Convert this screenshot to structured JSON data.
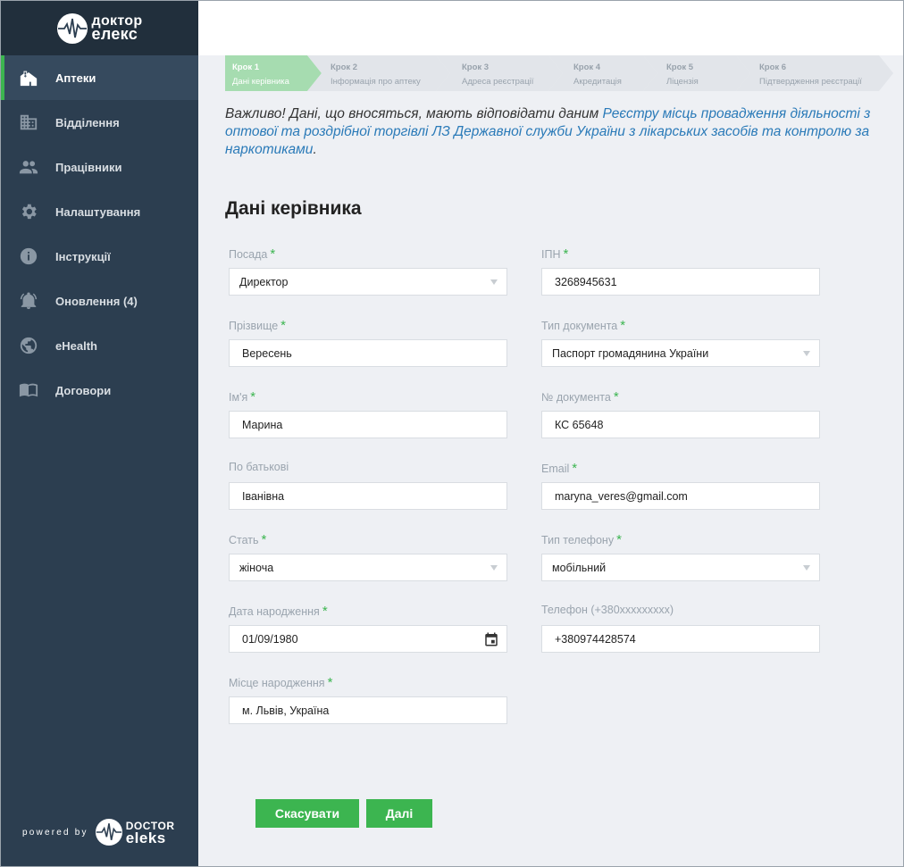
{
  "brand": {
    "logo_line1": "доктор",
    "logo_line2": "елекс",
    "icon": "heartbeat-icon"
  },
  "sidebar": {
    "items": [
      {
        "label": "Аптеки",
        "icon": "pharmacy-icon",
        "active": true
      },
      {
        "label": "Відділення",
        "icon": "building-icon",
        "active": false
      },
      {
        "label": "Працівники",
        "icon": "people-icon",
        "active": false
      },
      {
        "label": "Налаштування",
        "icon": "gear-icon",
        "active": false
      },
      {
        "label": "Інструкції",
        "icon": "info-icon",
        "active": false
      },
      {
        "label": "Оновлення (4)",
        "icon": "bell-icon",
        "active": false
      },
      {
        "label": "eHealth",
        "icon": "globe-icon",
        "active": false
      },
      {
        "label": "Договори",
        "icon": "book-icon",
        "active": false
      }
    ],
    "powered_by": "powered by",
    "powered_logo_line1": "DOCTOR",
    "powered_logo_line2": "eleks"
  },
  "steps": [
    {
      "title": "Крок 1",
      "subtitle": "Дані керівника",
      "active": true
    },
    {
      "title": "Крок 2",
      "subtitle": "Інформація про аптеку",
      "active": false
    },
    {
      "title": "Крок 3",
      "subtitle": "Адреса реєстрації",
      "active": false
    },
    {
      "title": "Крок 4",
      "subtitle": "Акредитація",
      "active": false
    },
    {
      "title": "Крок 5",
      "subtitle": "Ліцензія",
      "active": false
    },
    {
      "title": "Крок 6",
      "subtitle": "Підтвердження реєстрації",
      "active": false
    }
  ],
  "notice": {
    "text": "Важливо! Дані, що вносяться, мають відповідати даним ",
    "link": "Реєстру місць провадження діяльності з оптової та роздрібної торгівлі ЛЗ Державної служби України з лікарських засобів та контролю за наркотиками",
    "end": "."
  },
  "section_title": "Дані керівника",
  "form": {
    "position": {
      "label": "Посада",
      "value": "Директор"
    },
    "ipn": {
      "label": "ІПН",
      "value": "3268945631"
    },
    "surname": {
      "label": "Прізвище",
      "value": "Вересень"
    },
    "doc_type": {
      "label": "Тип документа",
      "value": "Паспорт громадянина України"
    },
    "name": {
      "label": "Ім'я",
      "value": "Марина"
    },
    "doc_number": {
      "label": "№ документа",
      "value": "КС 65648"
    },
    "patronymic": {
      "label": "По батькові",
      "value": "Іванівна"
    },
    "email": {
      "label": "Email",
      "value": "maryna_veres@gmail.com"
    },
    "gender": {
      "label": "Стать",
      "value": "жіноча"
    },
    "phone_type": {
      "label": "Тип телефону",
      "value": "мобільний"
    },
    "birth_date": {
      "label": "Дата народження",
      "value": "01/09/1980"
    },
    "phone": {
      "label": "Телефон (+380xxxxxxxxx)",
      "value": "+380974428574"
    },
    "birth_place": {
      "label": "Місце народження",
      "value": "м. Львів, Україна"
    },
    "required_mark": "*"
  },
  "buttons": {
    "cancel": "Скасувати",
    "next": "Далі"
  },
  "colors": {
    "accent": "#3cb550",
    "sidebar": "#2c3e50",
    "link": "#2a7ab8",
    "step_active": "#a6dcb0"
  }
}
